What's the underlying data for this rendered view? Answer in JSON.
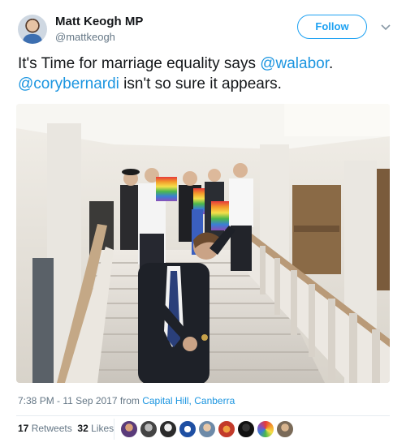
{
  "author": {
    "name": "Matt Keogh MP",
    "handle": "@mattkeogh",
    "follow_label": "Follow"
  },
  "tweet": {
    "text_part1": "It's Time for marriage equality says ",
    "mention1": "@walabor",
    "text_part2": ".",
    "mention2": "@corybernardi",
    "text_part3": " isn't so sure it appears."
  },
  "meta": {
    "time": "7:38 PM - 11 Sep 2017",
    "from_label": " from ",
    "place": "Capital Hill, Canberra"
  },
  "stats": {
    "retweets_count": "17",
    "retweets_label": "Retweets",
    "likes_count": "32",
    "likes_label": "Likes"
  },
  "colors": {
    "link": "#1b95e0",
    "follow": "#1da1f2",
    "secondary_text": "#657786"
  }
}
